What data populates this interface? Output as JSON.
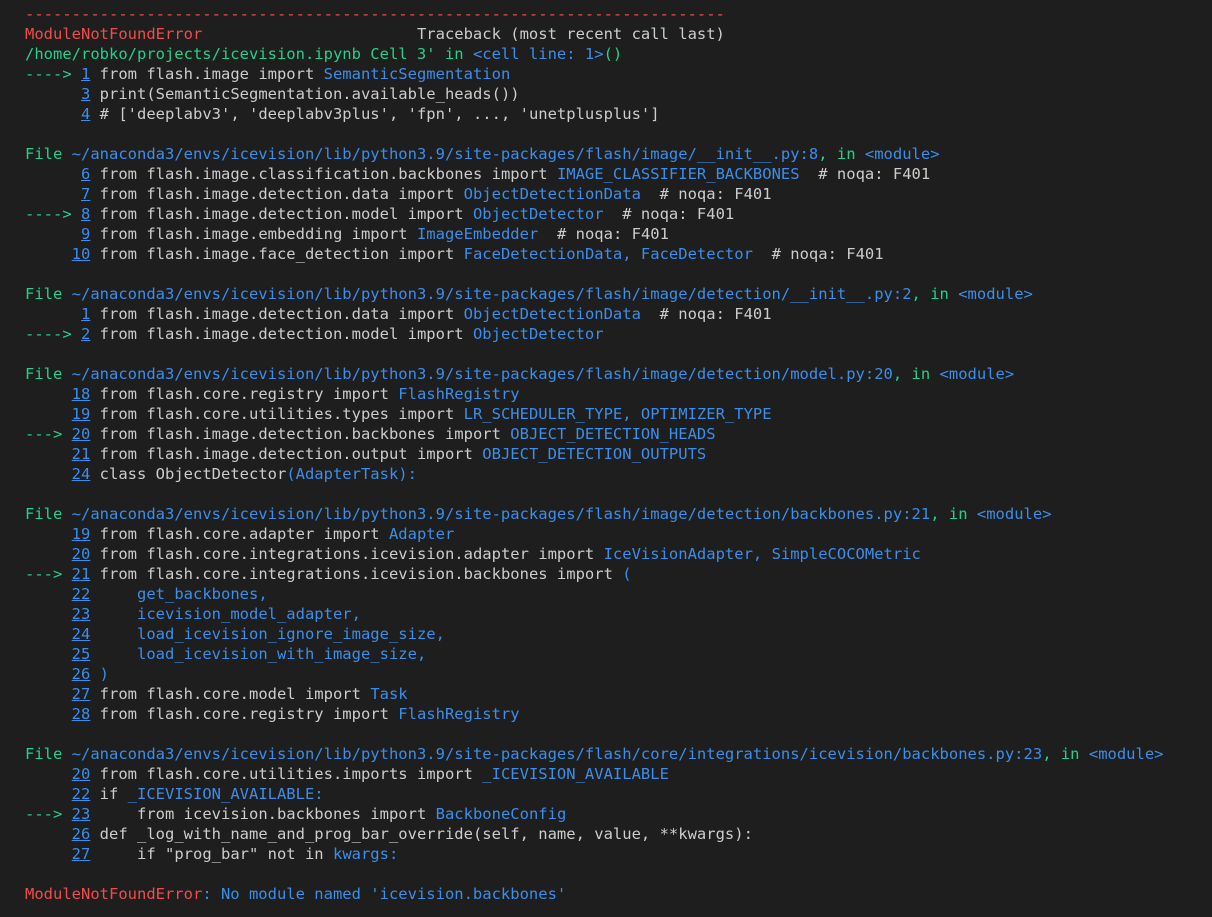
{
  "traceback": {
    "separator": "---------------------------------------------------------------------------",
    "lines": [
      [
        {
          "t": "ModuleNotFoundError",
          "c": "red"
        },
        {
          "t": "                       Traceback (most recent call last)",
          "c": "plain"
        }
      ],
      [
        {
          "t": "/home/robko/projects/icevision.ipynb Cell 3' in ",
          "c": "grn"
        },
        {
          "t": "<cell line: 1>",
          "c": "blu"
        },
        {
          "t": "()",
          "c": "grn"
        }
      ],
      [
        {
          "t": "----> ",
          "c": "grn"
        },
        {
          "t": "1",
          "c": "num"
        },
        {
          "t": " from flash.image import ",
          "c": "plain"
        },
        {
          "t": "SemanticSegmentation",
          "c": "blu"
        }
      ],
      [
        {
          "t": "      ",
          "c": "plain"
        },
        {
          "t": "3",
          "c": "num"
        },
        {
          "t": " print(SemanticSegmentation.available_heads())",
          "c": "plain"
        }
      ],
      [
        {
          "t": "      ",
          "c": "plain"
        },
        {
          "t": "4",
          "c": "num"
        },
        {
          "t": " # ['deeplabv3', 'deeplabv3plus', 'fpn', ..., 'unetplusplus']",
          "c": "plain"
        }
      ],
      [],
      [
        {
          "t": "File ",
          "c": "grn"
        },
        {
          "t": "~/anaconda3/envs/icevision/lib/python3.9/site-packages/flash/image/__init__.py:8",
          "c": "blu"
        },
        {
          "t": ", in ",
          "c": "grn"
        },
        {
          "t": "<module>",
          "c": "blu"
        }
      ],
      [
        {
          "t": "      ",
          "c": "plain"
        },
        {
          "t": "6",
          "c": "num"
        },
        {
          "t": " from flash.image.classification.backbones import ",
          "c": "plain"
        },
        {
          "t": "IMAGE_CLASSIFIER_BACKBONES",
          "c": "blu"
        },
        {
          "t": "  # noqa: F401",
          "c": "plain"
        }
      ],
      [
        {
          "t": "      ",
          "c": "plain"
        },
        {
          "t": "7",
          "c": "num"
        },
        {
          "t": " from flash.image.detection.data import ",
          "c": "plain"
        },
        {
          "t": "ObjectDetectionData",
          "c": "blu"
        },
        {
          "t": "  # noqa: F401",
          "c": "plain"
        }
      ],
      [
        {
          "t": "----> ",
          "c": "grn"
        },
        {
          "t": "8",
          "c": "num"
        },
        {
          "t": " from flash.image.detection.model import ",
          "c": "plain"
        },
        {
          "t": "ObjectDetector",
          "c": "blu"
        },
        {
          "t": "  # noqa: F401",
          "c": "plain"
        }
      ],
      [
        {
          "t": "      ",
          "c": "plain"
        },
        {
          "t": "9",
          "c": "num"
        },
        {
          "t": " from flash.image.embedding import ",
          "c": "plain"
        },
        {
          "t": "ImageEmbedder",
          "c": "blu"
        },
        {
          "t": "  # noqa: F401",
          "c": "plain"
        }
      ],
      [
        {
          "t": "     ",
          "c": "plain"
        },
        {
          "t": "10",
          "c": "num"
        },
        {
          "t": " from flash.image.face_detection import ",
          "c": "plain"
        },
        {
          "t": "FaceDetectionData, FaceDetector",
          "c": "blu"
        },
        {
          "t": "  # noqa: F401",
          "c": "plain"
        }
      ],
      [],
      [
        {
          "t": "File ",
          "c": "grn"
        },
        {
          "t": "~/anaconda3/envs/icevision/lib/python3.9/site-packages/flash/image/detection/__init__.py:2",
          "c": "blu"
        },
        {
          "t": ", in ",
          "c": "grn"
        },
        {
          "t": "<module>",
          "c": "blu"
        }
      ],
      [
        {
          "t": "      ",
          "c": "plain"
        },
        {
          "t": "1",
          "c": "num"
        },
        {
          "t": " from flash.image.detection.data import ",
          "c": "plain"
        },
        {
          "t": "ObjectDetectionData",
          "c": "blu"
        },
        {
          "t": "  # noqa: F401",
          "c": "plain"
        }
      ],
      [
        {
          "t": "----> ",
          "c": "grn"
        },
        {
          "t": "2",
          "c": "num"
        },
        {
          "t": " from flash.image.detection.model import ",
          "c": "plain"
        },
        {
          "t": "ObjectDetector",
          "c": "blu"
        }
      ],
      [],
      [
        {
          "t": "File ",
          "c": "grn"
        },
        {
          "t": "~/anaconda3/envs/icevision/lib/python3.9/site-packages/flash/image/detection/model.py:20",
          "c": "blu"
        },
        {
          "t": ", in ",
          "c": "grn"
        },
        {
          "t": "<module>",
          "c": "blu"
        }
      ],
      [
        {
          "t": "     ",
          "c": "plain"
        },
        {
          "t": "18",
          "c": "num"
        },
        {
          "t": " from flash.core.registry import ",
          "c": "plain"
        },
        {
          "t": "FlashRegistry",
          "c": "blu"
        }
      ],
      [
        {
          "t": "     ",
          "c": "plain"
        },
        {
          "t": "19",
          "c": "num"
        },
        {
          "t": " from flash.core.utilities.types import ",
          "c": "plain"
        },
        {
          "t": "LR_SCHEDULER_TYPE, OPTIMIZER_TYPE",
          "c": "blu"
        }
      ],
      [
        {
          "t": "---> ",
          "c": "grn"
        },
        {
          "t": "20",
          "c": "num"
        },
        {
          "t": " from flash.image.detection.backbones import ",
          "c": "plain"
        },
        {
          "t": "OBJECT_DETECTION_HEADS",
          "c": "blu"
        }
      ],
      [
        {
          "t": "     ",
          "c": "plain"
        },
        {
          "t": "21",
          "c": "num"
        },
        {
          "t": " from flash.image.detection.output import ",
          "c": "plain"
        },
        {
          "t": "OBJECT_DETECTION_OUTPUTS",
          "c": "blu"
        }
      ],
      [
        {
          "t": "     ",
          "c": "plain"
        },
        {
          "t": "24",
          "c": "num"
        },
        {
          "t": " class ObjectDetector",
          "c": "plain"
        },
        {
          "t": "(AdapterTask):",
          "c": "blu"
        }
      ],
      [],
      [
        {
          "t": "File ",
          "c": "grn"
        },
        {
          "t": "~/anaconda3/envs/icevision/lib/python3.9/site-packages/flash/image/detection/backbones.py:21",
          "c": "blu"
        },
        {
          "t": ", in ",
          "c": "grn"
        },
        {
          "t": "<module>",
          "c": "blu"
        }
      ],
      [
        {
          "t": "     ",
          "c": "plain"
        },
        {
          "t": "19",
          "c": "num"
        },
        {
          "t": " from flash.core.adapter import ",
          "c": "plain"
        },
        {
          "t": "Adapter",
          "c": "blu"
        }
      ],
      [
        {
          "t": "     ",
          "c": "plain"
        },
        {
          "t": "20",
          "c": "num"
        },
        {
          "t": " from flash.core.integrations.icevision.adapter import ",
          "c": "plain"
        },
        {
          "t": "IceVisionAdapter, SimpleCOCOMetric",
          "c": "blu"
        }
      ],
      [
        {
          "t": "---> ",
          "c": "grn"
        },
        {
          "t": "21",
          "c": "num"
        },
        {
          "t": " from flash.core.integrations.icevision.backbones import ",
          "c": "plain"
        },
        {
          "t": "(",
          "c": "blu"
        }
      ],
      [
        {
          "t": "     ",
          "c": "plain"
        },
        {
          "t": "22",
          "c": "num"
        },
        {
          "t": "     get_backbones,",
          "c": "blu"
        }
      ],
      [
        {
          "t": "     ",
          "c": "plain"
        },
        {
          "t": "23",
          "c": "num"
        },
        {
          "t": "     icevision_model_adapter,",
          "c": "blu"
        }
      ],
      [
        {
          "t": "     ",
          "c": "plain"
        },
        {
          "t": "24",
          "c": "num"
        },
        {
          "t": "     load_icevision_ignore_image_size,",
          "c": "blu"
        }
      ],
      [
        {
          "t": "     ",
          "c": "plain"
        },
        {
          "t": "25",
          "c": "num"
        },
        {
          "t": "     load_icevision_with_image_size,",
          "c": "blu"
        }
      ],
      [
        {
          "t": "     ",
          "c": "plain"
        },
        {
          "t": "26",
          "c": "num"
        },
        {
          "t": " )",
          "c": "blu"
        }
      ],
      [
        {
          "t": "     ",
          "c": "plain"
        },
        {
          "t": "27",
          "c": "num"
        },
        {
          "t": " from flash.core.model import ",
          "c": "plain"
        },
        {
          "t": "Task",
          "c": "blu"
        }
      ],
      [
        {
          "t": "     ",
          "c": "plain"
        },
        {
          "t": "28",
          "c": "num"
        },
        {
          "t": " from flash.core.registry import ",
          "c": "plain"
        },
        {
          "t": "FlashRegistry",
          "c": "blu"
        }
      ],
      [],
      [
        {
          "t": "File ",
          "c": "grn"
        },
        {
          "t": "~/anaconda3/envs/icevision/lib/python3.9/site-packages/flash/core/integrations/icevision/backbones.py:23",
          "c": "blu"
        },
        {
          "t": ", in ",
          "c": "grn"
        },
        {
          "t": "<module>",
          "c": "blu"
        }
      ],
      [
        {
          "t": "     ",
          "c": "plain"
        },
        {
          "t": "20",
          "c": "num"
        },
        {
          "t": " from flash.core.utilities.imports import ",
          "c": "plain"
        },
        {
          "t": "_ICEVISION_AVAILABLE",
          "c": "blu"
        }
      ],
      [
        {
          "t": "     ",
          "c": "plain"
        },
        {
          "t": "22",
          "c": "num"
        },
        {
          "t": " if ",
          "c": "plain"
        },
        {
          "t": "_ICEVISION_AVAILABLE:",
          "c": "blu"
        }
      ],
      [
        {
          "t": "---> ",
          "c": "grn"
        },
        {
          "t": "23",
          "c": "num"
        },
        {
          "t": "     from icevision.backbones import ",
          "c": "plain"
        },
        {
          "t": "BackboneConfig",
          "c": "blu"
        }
      ],
      [
        {
          "t": "     ",
          "c": "plain"
        },
        {
          "t": "26",
          "c": "num"
        },
        {
          "t": " def _log_with_name_and_prog_bar_override(self, name, value, **kwargs):",
          "c": "plain"
        }
      ],
      [
        {
          "t": "     ",
          "c": "plain"
        },
        {
          "t": "27",
          "c": "num"
        },
        {
          "t": "     if \"prog_bar\" not in ",
          "c": "plain"
        },
        {
          "t": "kwargs:",
          "c": "blu"
        }
      ],
      [],
      [
        {
          "t": "ModuleNotFoundError",
          "c": "red"
        },
        {
          "t": ": No module named 'icevision.backbones'",
          "c": "blu"
        }
      ]
    ]
  },
  "colors": {
    "background": "#1e1e1e",
    "red": "#f14c4c",
    "green": "#23d18b",
    "blue": "#3b8eea",
    "text": "#cccccc"
  }
}
